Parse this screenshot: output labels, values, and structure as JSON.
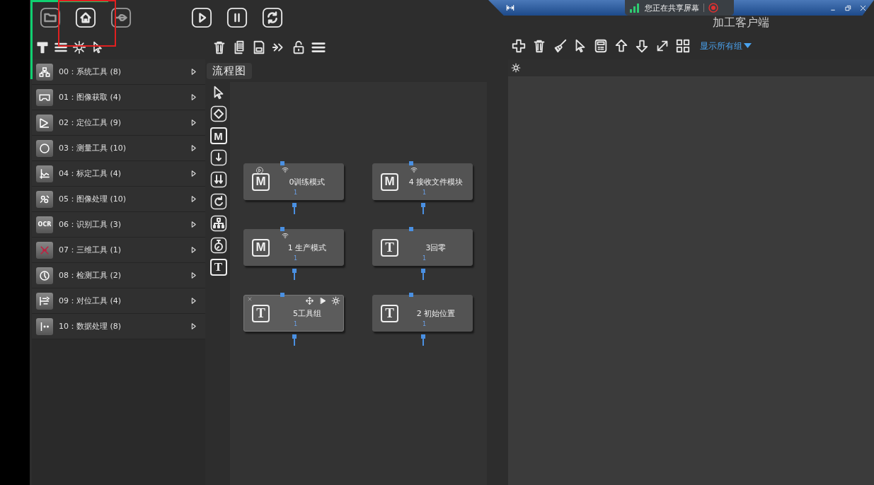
{
  "window": {
    "title": "加工客户端"
  },
  "share_bar": {
    "text": "您正在共享屏幕"
  },
  "flow_tab": {
    "label": "流程图"
  },
  "tool_categories": [
    {
      "label": "00：系统工具 (8)"
    },
    {
      "label": "01：图像获取 (4)"
    },
    {
      "label": "02：定位工具 (9)"
    },
    {
      "label": "03：测量工具 (10)"
    },
    {
      "label": "04：标定工具 (4)"
    },
    {
      "label": "05：图像处理 (10)"
    },
    {
      "label": "06：识别工具 (3)",
      "icon_text": "OCR"
    },
    {
      "label": "07：三维工具 (1)"
    },
    {
      "label": "08：检测工具 (2)"
    },
    {
      "label": "09：对位工具 (4)"
    },
    {
      "label": "10：数据处理 (8)"
    }
  ],
  "tool_palette": [
    {
      "kind": "pointer"
    },
    {
      "kind": "diamond"
    },
    {
      "kind": "letter",
      "text": "M"
    },
    {
      "kind": "down"
    },
    {
      "kind": "double-down"
    },
    {
      "kind": "loop"
    },
    {
      "kind": "tree"
    },
    {
      "kind": "timer"
    },
    {
      "kind": "letter",
      "text": "T"
    }
  ],
  "nodes": [
    {
      "letter": "M",
      "label": "0训练模式",
      "port_label": "1",
      "run_badge": true,
      "wifi": true,
      "selected": false
    },
    {
      "letter": "M",
      "label": "4 接收文件模块",
      "port_label": "1",
      "run_badge": false,
      "wifi": true,
      "selected": false
    },
    {
      "letter": "M",
      "label": "1 生产模式",
      "port_label": "1",
      "run_badge": false,
      "wifi": true,
      "selected": false
    },
    {
      "letter": "T",
      "label": "3回零",
      "port_label": "1",
      "run_badge": false,
      "wifi": false,
      "selected": false
    },
    {
      "letter": "T",
      "label": "5工具组",
      "port_label": "1",
      "run_badge": false,
      "wifi": false,
      "selected": true
    },
    {
      "letter": "T",
      "label": "2 初始位置",
      "port_label": "1",
      "run_badge": false,
      "wifi": false,
      "selected": false
    }
  ],
  "right_panel": {
    "group_filter": "显示所有组"
  }
}
